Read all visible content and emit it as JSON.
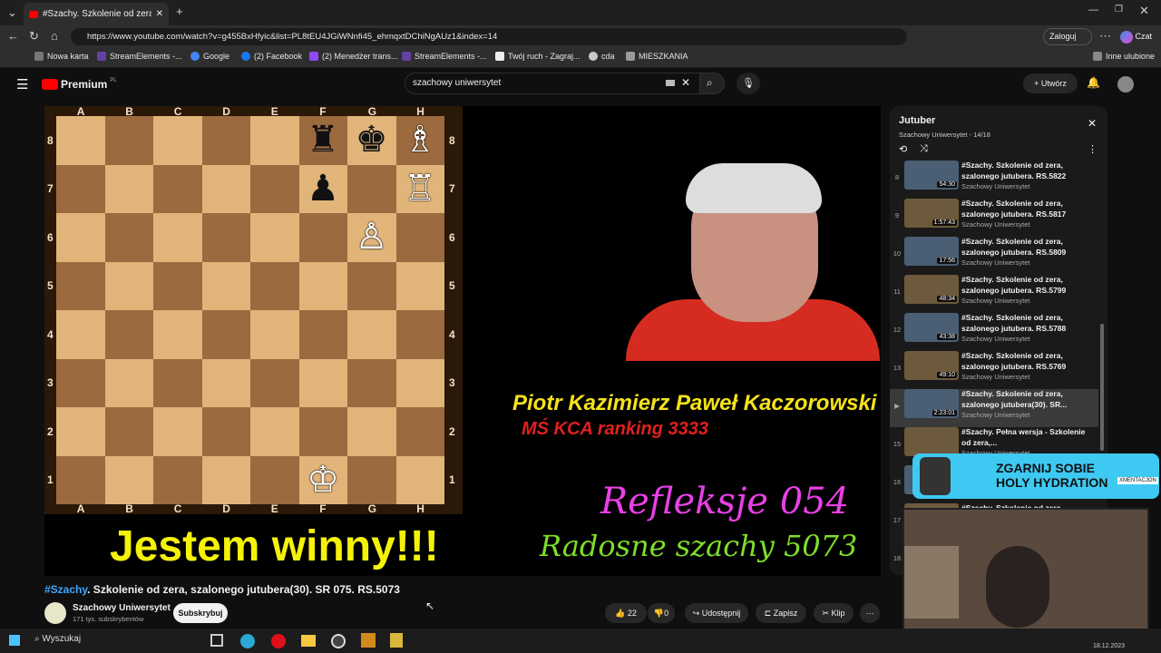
{
  "browser": {
    "tab_title": "#Szachy. Szkolenie od zera, sz",
    "url": "https://www.youtube.com/watch?v=g455BxHfyic&list=PL8tEU4JGiWNnfi45_ehmqxtDChiNgAUz1&index=14",
    "login_label": "Zaloguj",
    "copilot_label": "Czat",
    "bookmarks": [
      "Nowa karta",
      "StreamElements -...",
      "Google",
      "(2) Facebook",
      "(2) Menedżer trans...",
      "StreamElements -...",
      "Twój ruch - Zagraj...",
      "cda",
      "MIESZKANIA"
    ],
    "other_bookmarks": "Inne ulubione"
  },
  "yt": {
    "logo": "Premium",
    "logo_sup": "PL",
    "search_value": "szachowy uniwersytet",
    "create_label": "Utwórz"
  },
  "video": {
    "board_files": [
      "A",
      "B",
      "C",
      "D",
      "E",
      "F",
      "G",
      "H"
    ],
    "board_ranks": [
      "8",
      "7",
      "6",
      "5",
      "4",
      "3",
      "2",
      "1"
    ],
    "caption": "Jestem winny!!!",
    "name": "Piotr Kazimierz Paweł Kaczorowski",
    "rank": "MŚ KCA ranking 3333",
    "refleksje": "Refleksje 054",
    "radosne": "Radosne szachy 5073"
  },
  "playlist": {
    "title": "Jutuber",
    "subtitle": "Szachowy Uniwersytet",
    "position": "14/18",
    "items": [
      {
        "num": "8",
        "title": "#Szachy. Szkolenie od zera, szalonego jutubera. RS.5822",
        "channel": "Szachowy Uniwersytet",
        "duration": "54:30"
      },
      {
        "num": "9",
        "title": "#Szachy. Szkolenie od zera, szalonego jutubera. RS.5817",
        "channel": "Szachowy Uniwersytet",
        "duration": "1:57:43"
      },
      {
        "num": "10",
        "title": "#Szachy. Szkolenie od zera, szalonego jutubera. RS.5809",
        "channel": "Szachowy Uniwersytet",
        "duration": "17:56"
      },
      {
        "num": "11",
        "title": "#Szachy. Szkolenie od zera, szalonego jutubera. RS.5799",
        "channel": "Szachowy Uniwersytet",
        "duration": "48:34"
      },
      {
        "num": "12",
        "title": "#Szachy. Szkolenie od zera, szalonego jutubera. RS.5788",
        "channel": "Szachowy Uniwersytet",
        "duration": "43:38"
      },
      {
        "num": "13",
        "title": "#Szachy. Szkolenie od zera, szalonego jutubera. RS.5769",
        "channel": "Szachowy Uniwersytet",
        "duration": "49:10"
      },
      {
        "num": "▶",
        "title": "#Szachy. Szkolenie od zera, szalonego jutubera(30). SR...",
        "channel": "Szachowy Uniwersytet",
        "duration": "2:23:01"
      },
      {
        "num": "15",
        "title": "#Szachy. Pełna wersja - Szkolenie od zera,...",
        "channel": "Szachowy Uniwersytet",
        "duration": ""
      },
      {
        "num": "16",
        "title": "",
        "channel": "",
        "duration": ""
      },
      {
        "num": "17",
        "title": "#Szachy. Szkolenie od zera",
        "channel": "",
        "duration": ""
      },
      {
        "num": "18",
        "title": "",
        "channel": "",
        "duration": ""
      }
    ]
  },
  "meta": {
    "title_tag": "#Szachy",
    "title_rest": ". Szkolenie od zera, szalonego jutubera(30). SR 075. RS.5073",
    "channel": "Szachowy Uniwersytet",
    "subs": "171 tys. subskrybentów",
    "subscribe": "Subskrybuj",
    "likes": "22",
    "dislikes": "0",
    "share": "Udostępnij",
    "save": "Zapisz",
    "clip": "Klip"
  },
  "ad": {
    "line1": "ZGARNIJ SOBIE",
    "line2": "HOLY HYDRATION",
    "tag": "XMENTACJON"
  },
  "taskbar": {
    "search": "Wyszukaj",
    "date": "18.12.2023"
  }
}
